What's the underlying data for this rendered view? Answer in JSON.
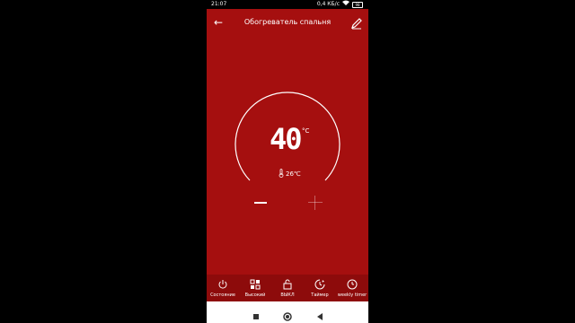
{
  "status_bar": {
    "time": "21:07",
    "network_speed": "0,4 КБ/с",
    "battery": "98"
  },
  "header": {
    "title": "Обогреватель спальня"
  },
  "thermostat": {
    "set_temperature": "40",
    "unit": "°C",
    "current_temperature": "26℃"
  },
  "tabs": [
    {
      "label": "Состояние",
      "icon": "power-icon"
    },
    {
      "label": "Высокий",
      "icon": "mode-grid-icon"
    },
    {
      "label": "ВЫКЛ",
      "icon": "lock-icon"
    },
    {
      "label": "Таймер",
      "icon": "timer-icon"
    },
    {
      "label": "weekly timer",
      "icon": "clock-icon"
    }
  ],
  "colors": {
    "background": "#a50f0f",
    "bottom_bar": "#8d0b0b"
  }
}
